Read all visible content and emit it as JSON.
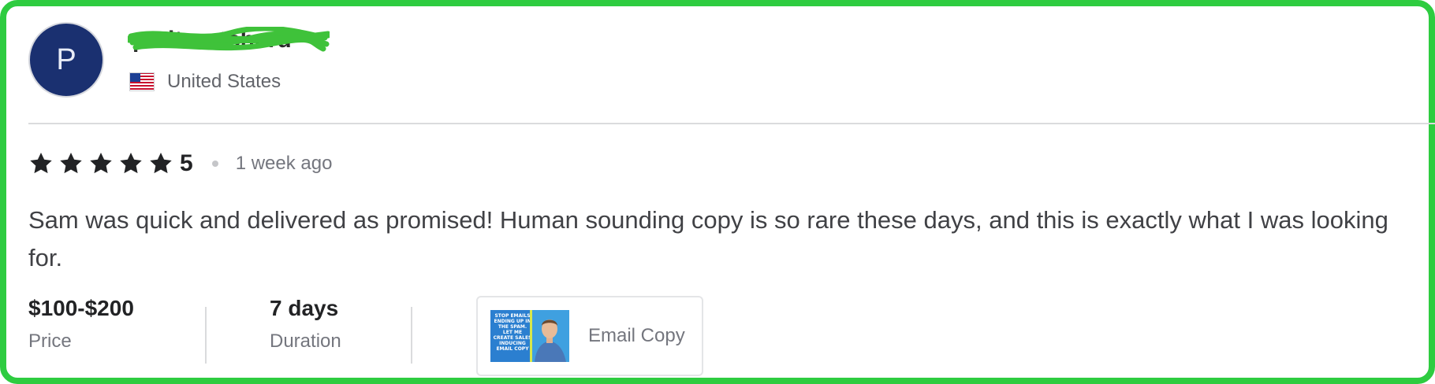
{
  "reviewer": {
    "avatar_initial": "P",
    "username": "petitcurtcherd",
    "country": "United States",
    "flag_icon": "us-flag-icon"
  },
  "review": {
    "stars": 5,
    "rating": "5",
    "time_ago": "1 week ago",
    "text": "Sam was quick and delivered as promised! Human sounding copy is so rare these days, and this is exactly what I was looking for."
  },
  "meta": {
    "price_value": "$100-$200",
    "price_label": "Price",
    "duration_value": "7 days",
    "duration_label": "Duration"
  },
  "gig": {
    "title": "Email Copy",
    "thumbnail_text": "STOP EMAILS ENDING UP IN THE SPAM. LET ME CREATE SALES INDUCING EMAIL COPY"
  },
  "colors": {
    "frame_border": "#2ecc40",
    "avatar_bg": "#1a3070",
    "scribble": "#3fc23a",
    "star": "#222325"
  }
}
